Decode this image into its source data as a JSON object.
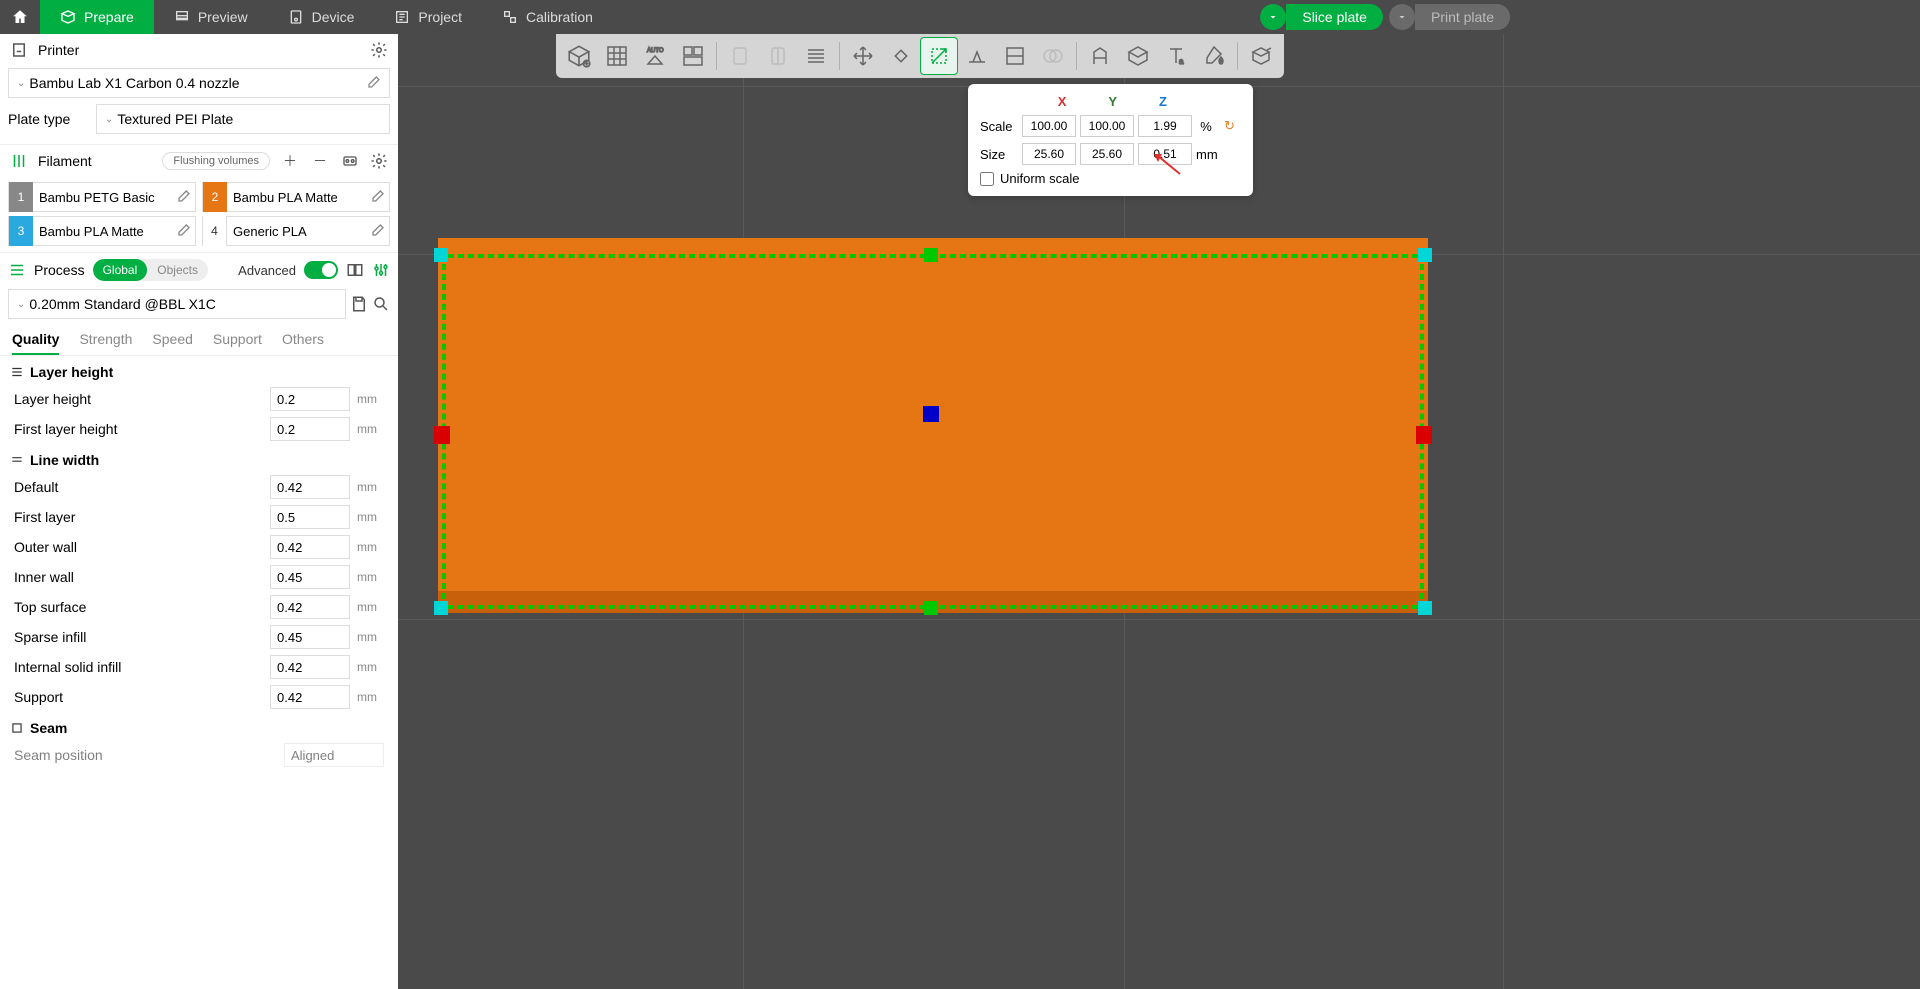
{
  "topbar": {
    "tabs": {
      "prepare": "Prepare",
      "preview": "Preview",
      "device": "Device",
      "project": "Project",
      "calibration": "Calibration"
    },
    "slice": "Slice plate",
    "print": "Print plate"
  },
  "printer": {
    "section": "Printer",
    "selected": "Bambu Lab X1 Carbon 0.4 nozzle",
    "plate_type_label": "Plate type",
    "plate_type": "Textured PEI Plate"
  },
  "filament": {
    "section": "Filament",
    "flushing": "Flushing volumes",
    "items": [
      {
        "num": "1",
        "name": "Bambu PETG Basic",
        "color": "#888888"
      },
      {
        "num": "2",
        "name": "Bambu PLA Matte",
        "color": "#e67613"
      },
      {
        "num": "3",
        "name": "Bambu PLA Matte",
        "color": "#2aa8e0"
      },
      {
        "num": "4",
        "name": "Generic PLA",
        "color": "#ffffff"
      }
    ]
  },
  "process": {
    "section": "Process",
    "global": "Global",
    "objects": "Objects",
    "advanced": "Advanced",
    "profile": "0.20mm Standard @BBL X1C",
    "tabs": {
      "quality": "Quality",
      "strength": "Strength",
      "speed": "Speed",
      "support": "Support",
      "others": "Others"
    }
  },
  "settings": {
    "layer_height_group": "Layer height",
    "layer_height": {
      "label": "Layer height",
      "value": "0.2",
      "unit": "mm"
    },
    "first_layer_height": {
      "label": "First layer height",
      "value": "0.2",
      "unit": "mm"
    },
    "line_width_group": "Line width",
    "default_lw": {
      "label": "Default",
      "value": "0.42",
      "unit": "mm"
    },
    "first_layer_lw": {
      "label": "First layer",
      "value": "0.5",
      "unit": "mm"
    },
    "outer_wall": {
      "label": "Outer wall",
      "value": "0.42",
      "unit": "mm"
    },
    "inner_wall": {
      "label": "Inner wall",
      "value": "0.45",
      "unit": "mm"
    },
    "top_surface": {
      "label": "Top surface",
      "value": "0.42",
      "unit": "mm"
    },
    "sparse_infill": {
      "label": "Sparse infill",
      "value": "0.45",
      "unit": "mm"
    },
    "internal_solid": {
      "label": "Internal solid infill",
      "value": "0.42",
      "unit": "mm"
    },
    "support": {
      "label": "Support",
      "value": "0.42",
      "unit": "mm"
    },
    "seam_group": "Seam",
    "seam_position": {
      "label": "Seam position",
      "value": "Aligned"
    }
  },
  "scale_panel": {
    "x": "X",
    "y": "Y",
    "z": "Z",
    "scale_label": "Scale",
    "scale_x": "100.00",
    "scale_y": "100.00",
    "scale_z": "1.99",
    "scale_unit": "%",
    "size_label": "Size",
    "size_x": "25.60",
    "size_y": "25.60",
    "size_z": "0.51",
    "size_unit": "mm",
    "uniform": "Uniform scale"
  }
}
